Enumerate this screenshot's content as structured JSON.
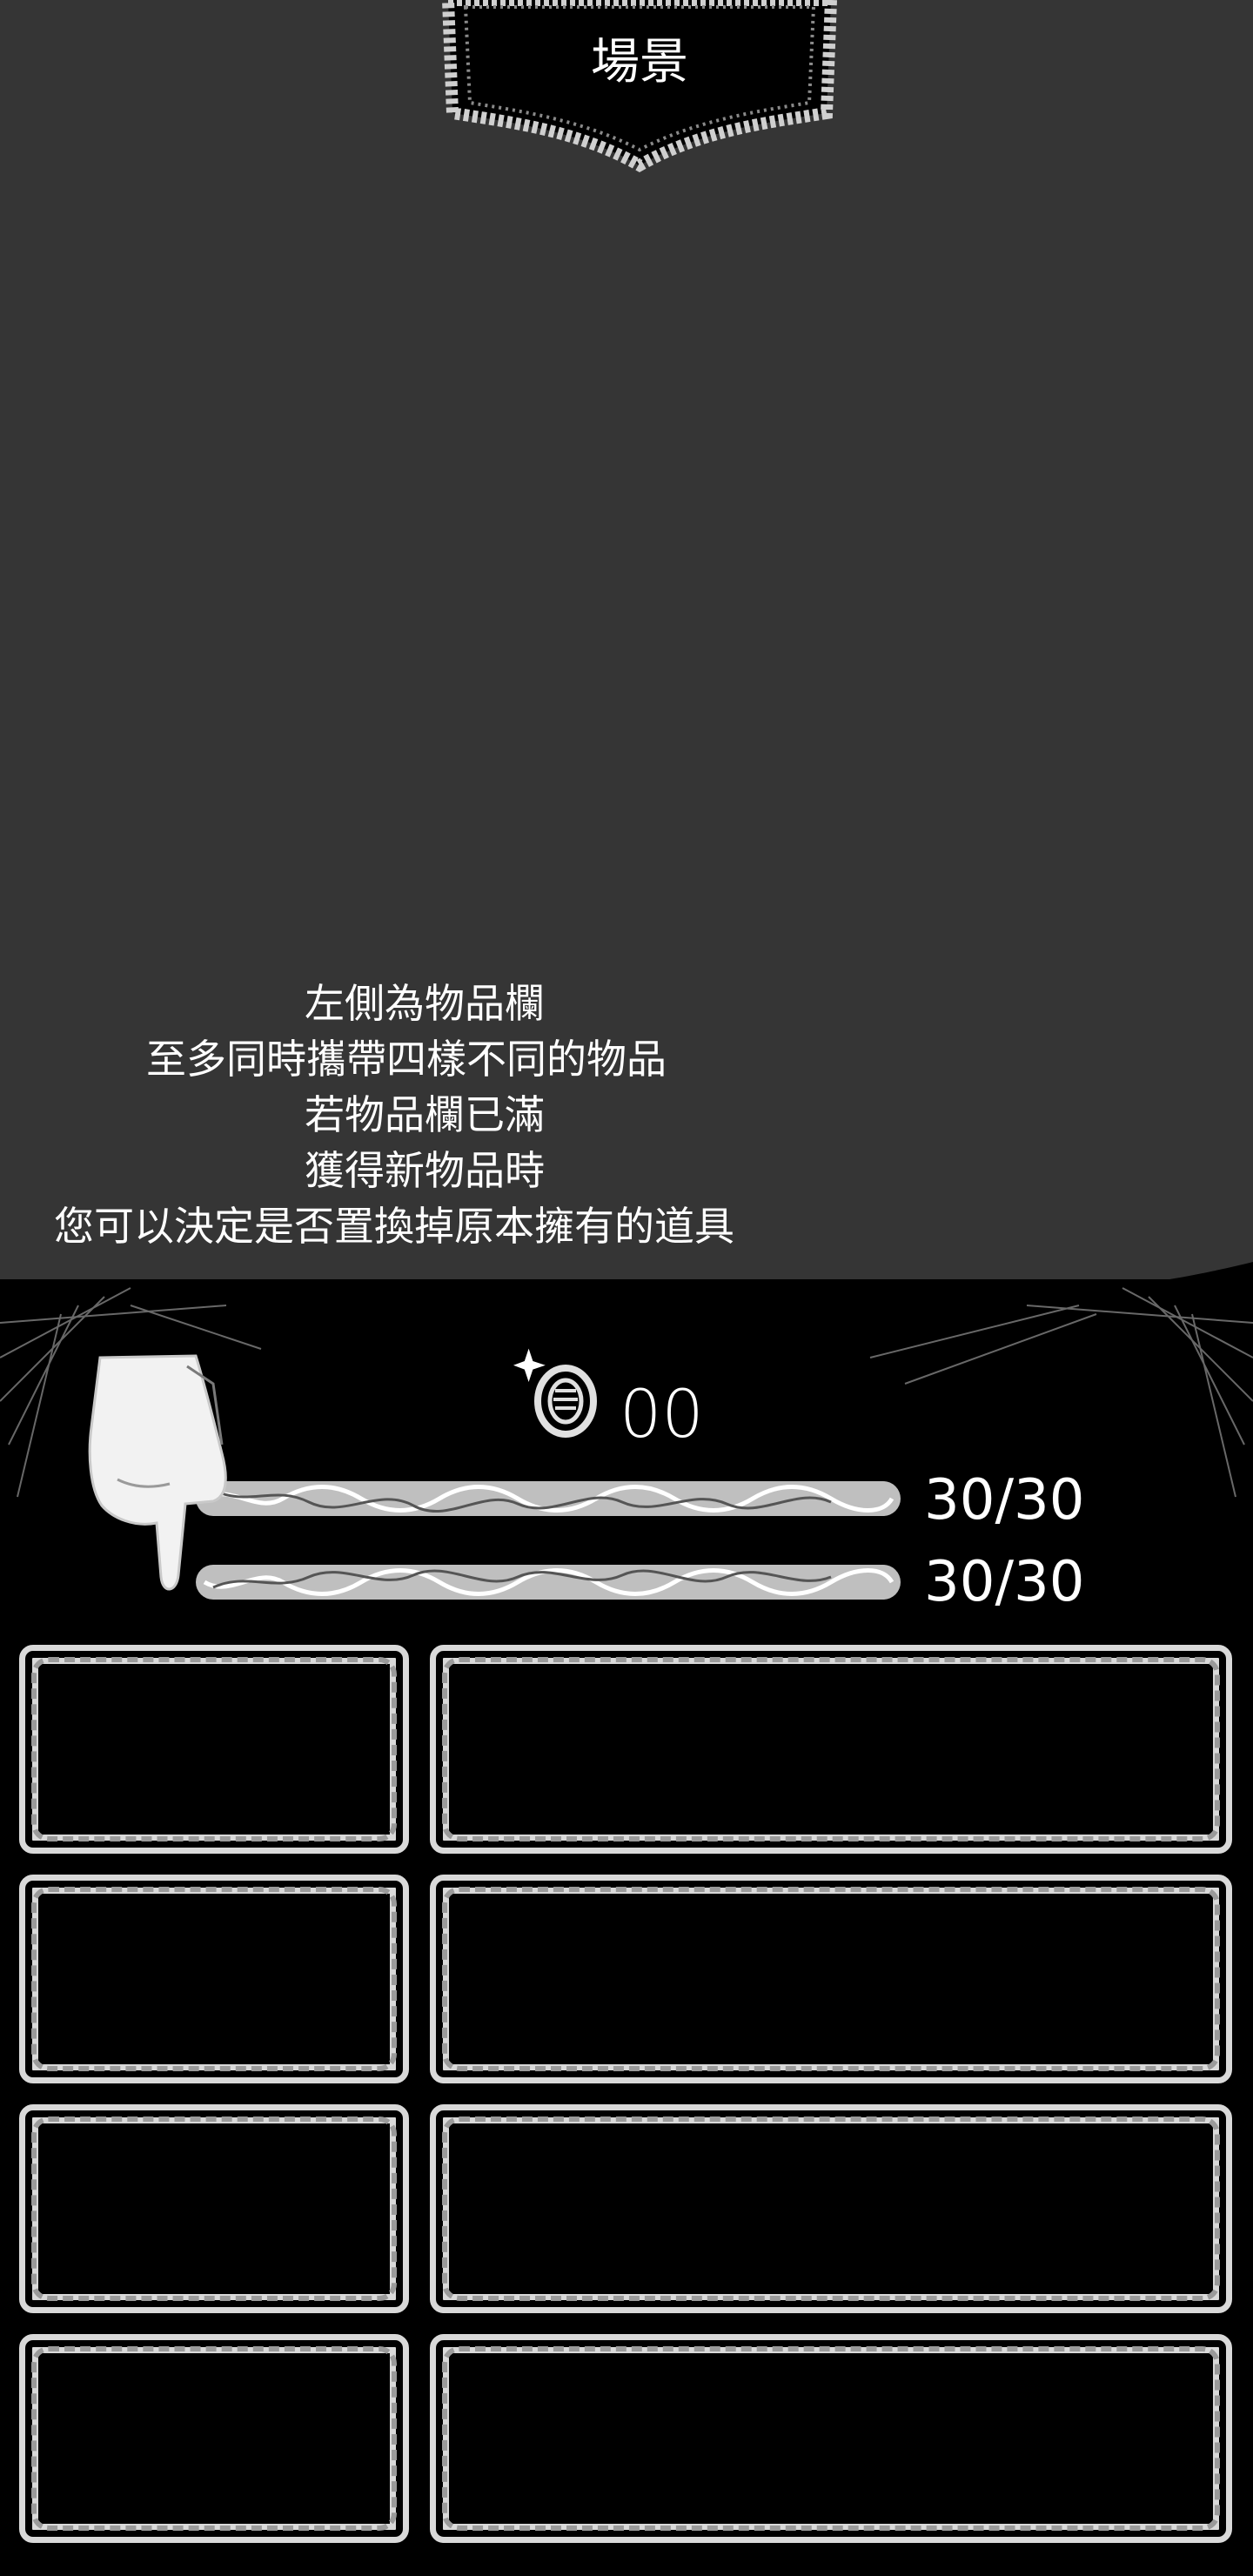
{
  "scene": {
    "title": "場景"
  },
  "tutorial": {
    "lines": [
      "左側為物品欄",
      "至多同時攜帶四樣不同的物品",
      "若物品欄已滿",
      "獲得新物品時",
      "您可以決定是否置換掉原本擁有的道具"
    ]
  },
  "hud": {
    "coin_count": "00",
    "health": "30/30",
    "stamina": "30/30",
    "health_fill": 1.0,
    "stamina_fill": 1.0
  },
  "inventory": {
    "slots": [
      {
        "icon": "",
        "description": ""
      },
      {
        "icon": "",
        "description": ""
      },
      {
        "icon": "",
        "description": ""
      },
      {
        "icon": "",
        "description": ""
      }
    ]
  },
  "icons": {
    "coin": "coin-icon",
    "hand": "pointing-hand-icon"
  },
  "colors": {
    "upper_background": "#353535",
    "lower_background": "#000000",
    "chalk": "#d9d9d9",
    "text": "#ffffff"
  }
}
